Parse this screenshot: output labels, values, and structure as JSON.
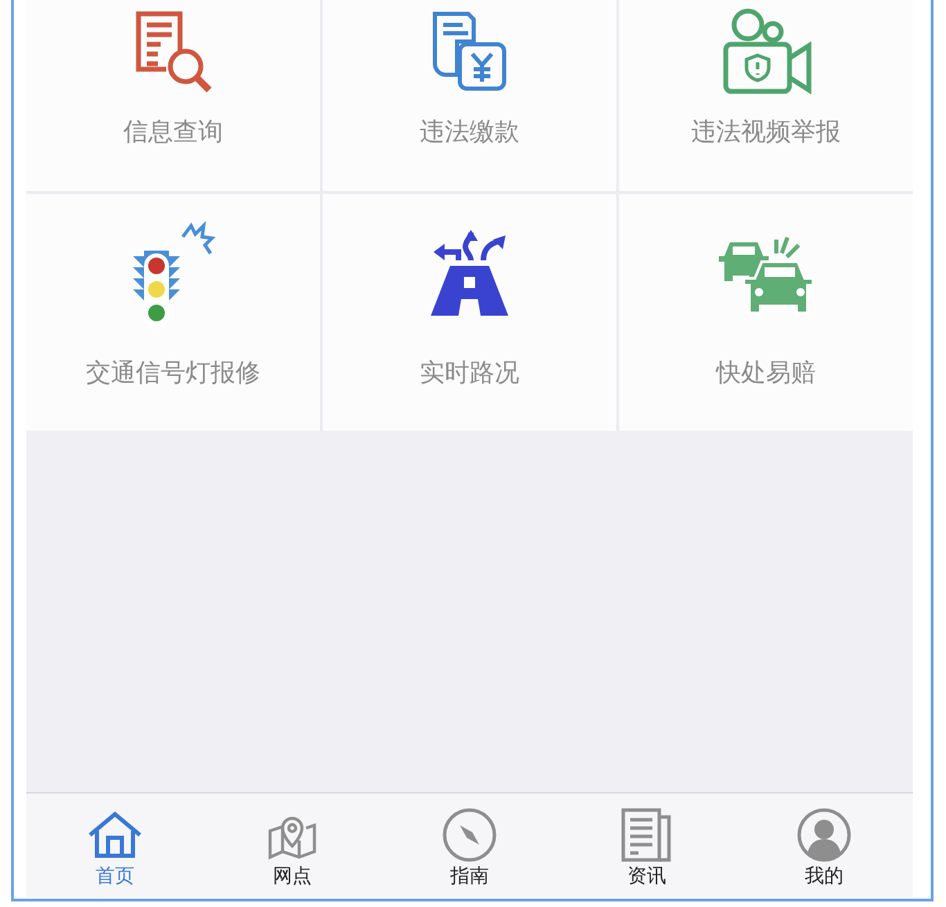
{
  "services": [
    {
      "kind": "search-doc",
      "label": "信息查询"
    },
    {
      "kind": "payment",
      "label": "违法缴款"
    },
    {
      "kind": "video",
      "label": "违法视频举报"
    },
    {
      "kind": "traffic-light",
      "label": "交通信号灯报修"
    },
    {
      "kind": "road",
      "label": "实时路况"
    },
    {
      "kind": "collision",
      "label": "快处易赔"
    }
  ],
  "tab_bar": [
    {
      "kind": "home",
      "label": "首页",
      "selected": true
    },
    {
      "kind": "map",
      "label": "网点",
      "selected": false
    },
    {
      "kind": "compass",
      "label": "指南",
      "selected": false
    },
    {
      "kind": "news",
      "label": "资讯",
      "selected": false
    },
    {
      "kind": "user",
      "label": "我的",
      "selected": false
    }
  ]
}
